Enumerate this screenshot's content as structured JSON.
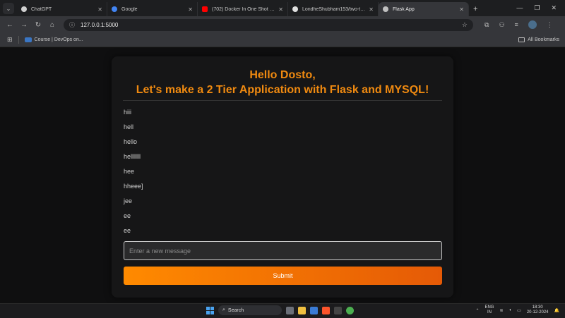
{
  "browser": {
    "tabs": [
      {
        "title": "ChatGPT",
        "favicon_color": "#d0d0d0"
      },
      {
        "title": "Google",
        "favicon_color": "#4285f4"
      },
      {
        "title": "(702) Docker In One Shot with...",
        "favicon_color": "#ff0000"
      },
      {
        "title": "LondheShubham153/two-tier...",
        "favicon_color": "#e0e0e0"
      },
      {
        "title": "Flask App",
        "favicon_color": "#c0c0c0",
        "active": true
      }
    ],
    "url": "127.0.0.1:5000",
    "bookmark": "Course | DevOps on...",
    "all_bookmarks": "All Bookmarks"
  },
  "page": {
    "title_line1": "Hello Dosto,",
    "title_line2": "Let's make a 2 Tier Application with Flask and MYSQL!",
    "messages": [
      "hiii",
      "hell",
      "hello",
      "helllllll",
      "hee",
      "hheee]",
      "jee",
      "ee",
      "ee"
    ],
    "input_placeholder": "Enter a new message",
    "submit_label": "Submit",
    "accent_color": "#f08a10"
  },
  "taskbar": {
    "search": "Search",
    "lang_top": "ENG",
    "lang_bottom": "IN",
    "time": "18:30",
    "date": "20-12-2024"
  }
}
